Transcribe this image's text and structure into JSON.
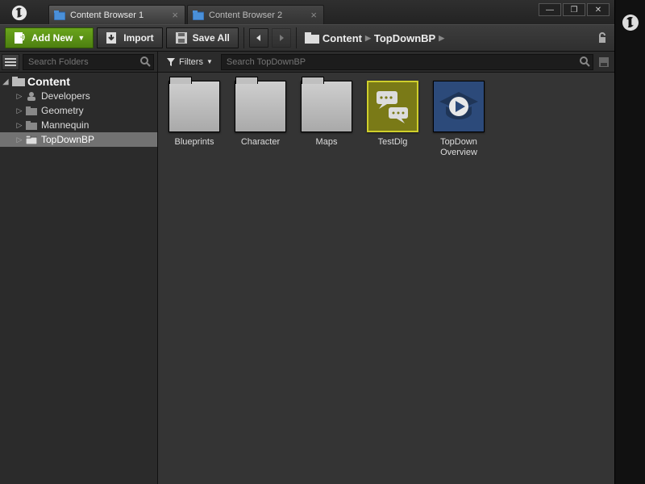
{
  "window": {
    "tabs": [
      {
        "label": "Content Browser 1",
        "active": true
      },
      {
        "label": "Content Browser 2",
        "active": false
      }
    ],
    "controls": {
      "min": "—",
      "max": "❐",
      "close": "✕"
    }
  },
  "toolbar": {
    "add_new": "Add New",
    "import": "Import",
    "save_all": "Save All"
  },
  "breadcrumb": {
    "root": "Content",
    "path": [
      "TopDownBP"
    ]
  },
  "sidebar": {
    "search_placeholder": "Search Folders",
    "root": "Content",
    "items": [
      {
        "label": "Developers",
        "icon": "user"
      },
      {
        "label": "Geometry",
        "icon": "folder"
      },
      {
        "label": "Mannequin",
        "icon": "folder"
      },
      {
        "label": "TopDownBP",
        "icon": "folder",
        "selected": true
      }
    ]
  },
  "content": {
    "filters_label": "Filters",
    "search_placeholder": "Search TopDownBP",
    "assets": [
      {
        "label": "Blueprints",
        "type": "folder"
      },
      {
        "label": "Character",
        "type": "folder"
      },
      {
        "label": "Maps",
        "type": "folder"
      },
      {
        "label": "TestDlg",
        "type": "dialog-asset"
      },
      {
        "label": "TopDown\nOverview",
        "type": "tutorial-asset"
      }
    ]
  }
}
